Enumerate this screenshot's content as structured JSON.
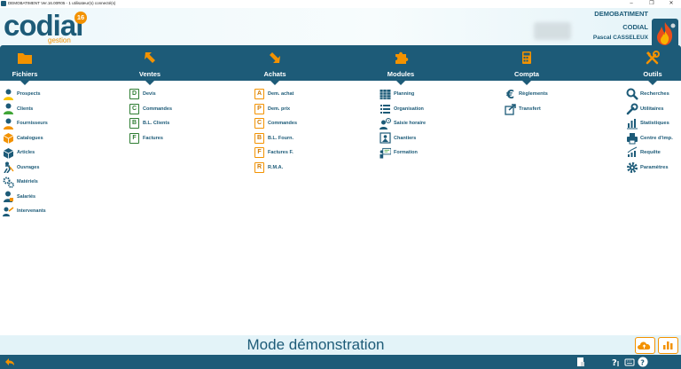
{
  "window": {
    "title": "DEMOBATIMENT Ver.16.00R05 - 1 utilisateur(s) connecté(s)",
    "controls": [
      "–",
      "❐",
      "✕"
    ]
  },
  "header": {
    "logo_text": "codial",
    "logo_version": "16",
    "logo_sub": "gestion",
    "company": "DEMOBATIMENT",
    "site": "CODIAL",
    "user": "Pascal CASSELEUX"
  },
  "colors": {
    "primary": "#1d5b78",
    "accent": "#f39200",
    "green": "#2e7d32",
    "mode_bg": "#e3f3f8"
  },
  "nav": [
    {
      "label": "Fichiers",
      "icon": "folder-icon"
    },
    {
      "label": "Ventes",
      "icon": "arrow-up-left-icon"
    },
    {
      "label": "Achats",
      "icon": "arrow-down-right-icon"
    },
    {
      "label": "Modules",
      "icon": "puzzle-icon"
    },
    {
      "label": "Compta",
      "icon": "calculator-icon"
    },
    {
      "label": "Outils",
      "icon": "tools-icon"
    }
  ],
  "menus": {
    "fichiers": [
      "Prospects",
      "Clients",
      "Fournisseurs",
      "Catalogues",
      "Articles",
      "Ouvrages",
      "Matériels",
      "Salariés",
      "Intervenants"
    ],
    "ventes": [
      {
        "label": "Devis",
        "letter": "D"
      },
      {
        "label": "Commandes",
        "letter": "C"
      },
      {
        "label": "B.L. Clients",
        "letter": "B"
      },
      {
        "label": "Factures",
        "letter": "F"
      }
    ],
    "achats": [
      {
        "label": "Dem. achat",
        "letter": "A"
      },
      {
        "label": "Dem. prix",
        "letter": "P"
      },
      {
        "label": "Commandes",
        "letter": "C"
      },
      {
        "label": "B.L. Fourn.",
        "letter": "B"
      },
      {
        "label": "Factures F.",
        "letter": "F"
      },
      {
        "label": "R.M.A.",
        "letter": "R"
      }
    ],
    "modules": [
      "Planning",
      "Organisation",
      "Saisie horaire",
      "Chantiers",
      "Formation"
    ],
    "compta": [
      "Règlements",
      "Transfert"
    ],
    "outils": [
      "Recherches",
      "Utilitaires",
      "Statistiques",
      "Centre d'imp.",
      "Requête",
      "Paramètres"
    ]
  },
  "footer": {
    "mode_text": "Mode démonstration"
  }
}
